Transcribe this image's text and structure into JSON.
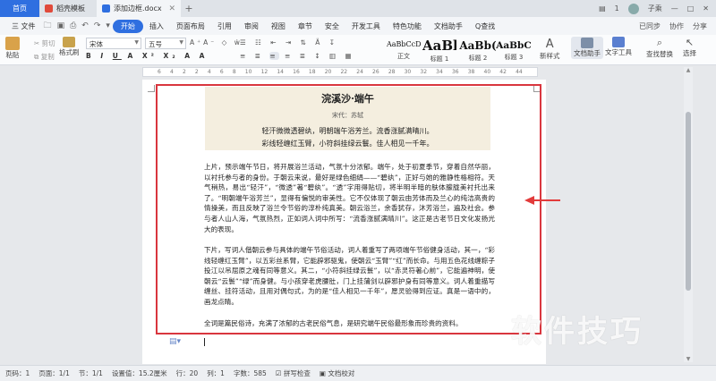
{
  "tabbar": {
    "home": "首页",
    "tabs": [
      {
        "label": "稻壳模板",
        "color": "#e04a3a"
      },
      {
        "label": "添加边框.docx",
        "color": "#2f6fe0"
      }
    ],
    "add": "+",
    "right_badge": "1",
    "user": "子乘"
  },
  "menubar": {
    "file": "三 文件",
    "items": [
      "开始",
      "插入",
      "页面布局",
      "引用",
      "审阅",
      "视图",
      "章节",
      "安全",
      "开发工具",
      "特色功能",
      "文档助手"
    ],
    "search": "Q查找",
    "right": [
      "已同步",
      "协作",
      "分享"
    ]
  },
  "ribbon": {
    "paste": "粘贴",
    "cut": "剪切",
    "copy": "复制",
    "format_painter": "格式刷",
    "font": "宋体",
    "size": "五号",
    "styles": [
      {
        "sample": "AaBbCcDd",
        "label": "正文"
      },
      {
        "sample": "AaBl",
        "label": "标题 1"
      },
      {
        "sample": "AaBb(",
        "label": "标题 2"
      },
      {
        "sample": "AaBbC",
        "label": "标题 3"
      }
    ],
    "new_style": "新样式",
    "doc_assistant": "文档助手",
    "text_tools": "文字工具",
    "find_replace": "查找替换",
    "select": "选择"
  },
  "ruler": [
    "6",
    "4",
    "2",
    "2",
    "4",
    "6",
    "8",
    "10",
    "12",
    "14",
    "16",
    "18",
    "20",
    "22",
    "24",
    "26",
    "28",
    "30",
    "32",
    "34",
    "36",
    "38",
    "40",
    "42",
    "44"
  ],
  "document": {
    "poem_title": "浣溪沙·端午",
    "poem_author": "宋代：苏轼",
    "poem_line1": "轻汗微微透碧纨，明朝端午浴芳兰。流香涨腻满晴川。",
    "poem_line2": "彩线轻缠红玉臂，小符斜挂绿云鬟。佳人相见一千年。",
    "para1": "上片，预示端午节日，将开展浴兰活动，气氛十分浓郁。端午，处于初夏季节，穿着自然华丽，以衬托参与者的身份。于朝云来说，最好是绿色细绢——“碧纨”，正好与她的雅静性格相符。天气稍热，易出“轻汗”，“微透”著“碧纨”。“透”字用得贴切，将半明半暗的肤体朦胧美衬托出来了。“明朝端午浴芳兰”，显得有偏悦的审美性。它不仅体现了朝云由芳体而及兰心的纯洁高贵的情操美，而且反映了浴兰令节俗的淳朴纯真美。朝云浴兰，余香犹存，沐芳浴兰，遍及社会。参与者人山人海，气氛热烈，正如词人词中所写：“流香涨腻满晴川”。这正是古老节日文化发扬光大的表现。",
    "para2": "下片，写词人偕朝云参与具体的端午节俗活动，词人着重写了两项端午节俗健身活动，其一，“彩线轻缠红玉臂”，以五彩丝系臂，它能辟邪驱鬼，使朝云“玉臂”“红”而长命。与用五色花线缠粽子投江以吊屈原之魂有同等意义。其二，“小符斜挂绿云鬟”，以“赤灵符著心前”，它能遍神明，使朝云“云鬟”“绿”而身健。与小孩穿老虎腰肚，门上挂蒲剑以辟邪护身有同等意义。词人着重描写缠丝、挂符活动，且用对偶句式，为的是“佳人相见一千年”，愿灵验得到应证。真是一语中的，画龙点睛。",
    "para3": "全词是篇民俗诗，充满了浓郁的古老民俗气息，是研究端午民俗最形象而珍贵的资料。"
  },
  "watermark": "软件技巧",
  "statusbar": {
    "page": "页码：1",
    "pages": "页面：1/1",
    "section": "节：1/1",
    "setting": "设置值：15.2厘米",
    "row": "行：20",
    "col": "列：1",
    "words": "字数：585",
    "spell": "拼写检查",
    "proof": "文档校对"
  },
  "colors": {
    "accent": "#2f6fe0",
    "frame": "#d9363e",
    "poem_bg": "#f4eedf"
  }
}
